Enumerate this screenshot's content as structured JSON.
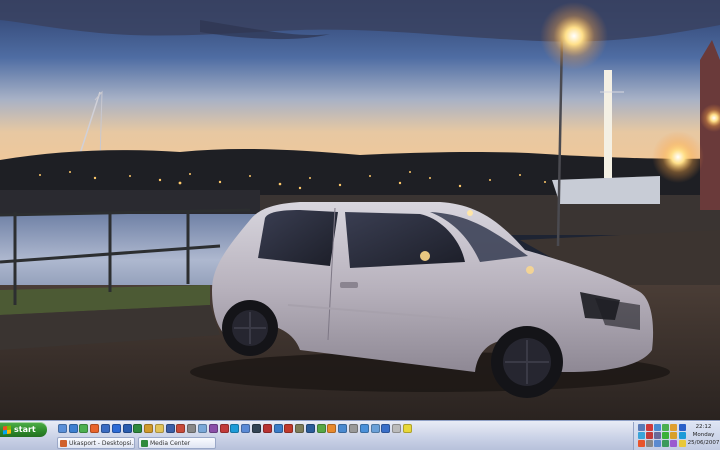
{
  "taskbar": {
    "start_label": "start",
    "quick_launch_icons": [
      {
        "name": "show-desktop-icon",
        "color": "#5a8fd8"
      },
      {
        "name": "internet-explorer-icon",
        "color": "#3d7fd1"
      },
      {
        "name": "messenger-icon",
        "color": "#4caf50"
      },
      {
        "name": "firefox-icon",
        "color": "#e8642c"
      },
      {
        "name": "media-player-icon",
        "color": "#3a6bc2"
      },
      {
        "name": "outlook-icon",
        "color": "#2d6bd6"
      },
      {
        "name": "word-icon",
        "color": "#2a5db0"
      },
      {
        "name": "excel-icon",
        "color": "#2f8a3d"
      },
      {
        "name": "winamp-icon",
        "color": "#d09a2c"
      },
      {
        "name": "folder-icon",
        "color": "#e2c35a"
      },
      {
        "name": "photoshop-icon",
        "color": "#3b5fa8"
      },
      {
        "name": "paint-icon",
        "color": "#c84a3a"
      },
      {
        "name": "calculator-icon",
        "color": "#888888"
      },
      {
        "name": "notepad-icon",
        "color": "#7aa8d8"
      },
      {
        "name": "winrar-icon",
        "color": "#8a4fa8"
      },
      {
        "name": "daemon-tools-icon",
        "color": "#c23a3a"
      },
      {
        "name": "skype-icon",
        "color": "#1d9bd8"
      },
      {
        "name": "itunes-icon",
        "color": "#5a8ad6"
      },
      {
        "name": "steam-icon",
        "color": "#334455"
      },
      {
        "name": "nero-icon",
        "color": "#b83333"
      },
      {
        "name": "explorer-icon",
        "color": "#3a7cc8"
      },
      {
        "name": "acrobat-icon",
        "color": "#c0392b"
      },
      {
        "name": "gimp-icon",
        "color": "#7d7d5a"
      },
      {
        "name": "teamspeak-icon",
        "color": "#2a5d9a"
      },
      {
        "name": "utorrent-icon",
        "color": "#57a845"
      },
      {
        "name": "vlc-icon",
        "color": "#e8892c"
      },
      {
        "name": "search-icon",
        "color": "#4a8ad0"
      },
      {
        "name": "printer-icon",
        "color": "#999999"
      },
      {
        "name": "network-icon",
        "color": "#4a90d9"
      },
      {
        "name": "control-panel-icon",
        "color": "#6aa0d8"
      },
      {
        "name": "help-icon",
        "color": "#3a6fc8"
      },
      {
        "name": "clock-app-icon",
        "color": "#bbbbbb"
      },
      {
        "name": "lightbulb-icon",
        "color": "#e8d83a"
      }
    ],
    "tasks": [
      {
        "name": "task-ukasport-desktop",
        "label": "Ukasport - Desktopsi...",
        "icon_color": "#d0612c",
        "width": 78
      },
      {
        "name": "task-media-center",
        "label": "Media Center",
        "icon_color": "#2f8a3d",
        "width": 78
      }
    ],
    "tray": {
      "icons": [
        {
          "name": "volume-icon",
          "color": "#5a7bb8"
        },
        {
          "name": "antivirus-icon",
          "color": "#d03a3a"
        },
        {
          "name": "network-tray-icon",
          "color": "#4a8ad0"
        },
        {
          "name": "messenger-tray-icon",
          "color": "#4caf50"
        },
        {
          "name": "update-icon",
          "color": "#e0a030"
        },
        {
          "name": "bluetooth-icon",
          "color": "#2a5fc8"
        },
        {
          "name": "msn-icon",
          "color": "#3aa3d8"
        },
        {
          "name": "security-icon",
          "color": "#c23a3a"
        },
        {
          "name": "display-icon",
          "color": "#6a6a9a"
        },
        {
          "name": "battery-icon",
          "color": "#3ab03a"
        },
        {
          "name": "shield-icon",
          "color": "#d8a02a"
        },
        {
          "name": "skype-tray-icon",
          "color": "#1d9bd8"
        },
        {
          "name": "flag-icon",
          "color": "#e8542c"
        },
        {
          "name": "printer-tray-icon",
          "color": "#888888"
        },
        {
          "name": "usb-icon",
          "color": "#5a8ad0"
        },
        {
          "name": "sync-icon",
          "color": "#3a9a5a"
        },
        {
          "name": "music-icon",
          "color": "#9a5ad0"
        },
        {
          "name": "chat-icon",
          "color": "#e8c83a"
        }
      ],
      "time": "22:12",
      "day": "Monday",
      "date": "25/06/2007"
    }
  }
}
